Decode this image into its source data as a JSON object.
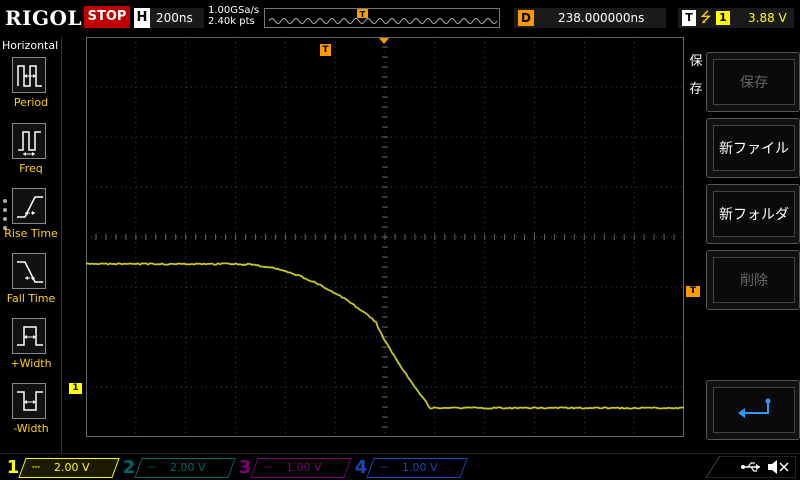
{
  "header": {
    "brand": "RIGOL",
    "run_status": "STOP",
    "timebase_label": "H",
    "timebase_value": "200ns",
    "sample_rate": "1.00GSa/s",
    "memory_depth": "2.40k pts",
    "delay_label": "D",
    "delay_value": "238.000000ns",
    "trigger_label": "T",
    "trigger_source": "1",
    "trigger_level": "3.88 V"
  },
  "sidebar": {
    "title": "Horizontal",
    "items": [
      {
        "label": "Period",
        "icon": "period-icon"
      },
      {
        "label": "Freq",
        "icon": "frequency-icon"
      },
      {
        "label": "Rise Time",
        "icon": "rise-time-icon"
      },
      {
        "label": "Fall Time",
        "icon": "fall-time-icon"
      },
      {
        "label": "+Width",
        "icon": "positive-width-icon"
      },
      {
        "label": "-Width",
        "icon": "negative-width-icon"
      }
    ]
  },
  "markers": {
    "trigger_position": "T",
    "ch1_offset": "1",
    "trigger_level": "T"
  },
  "right_menu": {
    "tab_label_1": "保",
    "tab_label_2": "存",
    "buttons": [
      {
        "label": "保存",
        "enabled": false
      },
      {
        "label": "新ファイル",
        "enabled": true
      },
      {
        "label": "新フォルダ",
        "enabled": true
      },
      {
        "label": "削除",
        "enabled": false
      },
      {
        "label": "",
        "icon": "return-icon",
        "enabled": true
      }
    ]
  },
  "channels": [
    {
      "num": "1",
      "scale": "2.00 V",
      "color": "#ffff00",
      "active": true
    },
    {
      "num": "2",
      "scale": "2.00 V",
      "color": "#00a0a0",
      "active": false
    },
    {
      "num": "3",
      "scale": "1.00 V",
      "color": "#b000b0",
      "active": false
    },
    {
      "num": "4",
      "scale": "1.00 V",
      "color": "#2060ff",
      "active": false
    }
  ],
  "colors": {
    "ch1": "#ffff00",
    "trace": "#c8c820",
    "trigger": "#ff9900",
    "stop": "#c00000"
  }
}
